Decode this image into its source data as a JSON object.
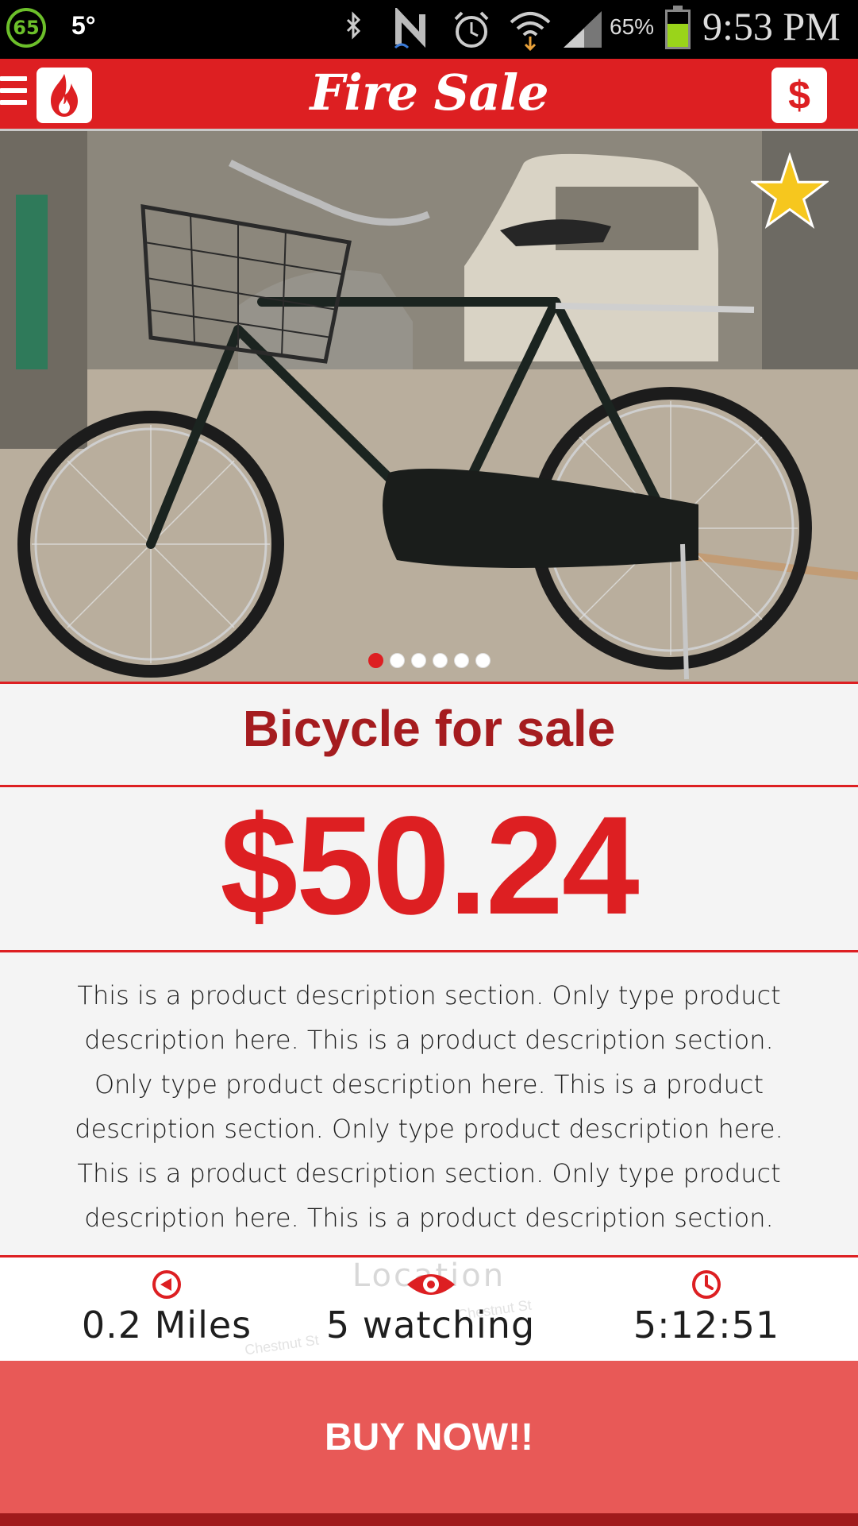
{
  "status_bar": {
    "notification_badge": "65",
    "temperature": "5°",
    "battery_percent": "65%",
    "battery_level": 0.65,
    "time": "9:53 PM",
    "icons": [
      "bluetooth-icon",
      "nfc-icon",
      "alarm-icon",
      "wifi-icon",
      "signal-icon",
      "battery-icon"
    ]
  },
  "header": {
    "title": "Fire Sale",
    "menu_icon": "hamburger-icon",
    "logo_icon": "flame-icon",
    "action_label": "$",
    "brand_color": "#dd1f22"
  },
  "gallery": {
    "image_subject": "bicycle-photo",
    "favorite_icon": "star-icon",
    "favorite_color": "#f6c71e",
    "dots_total": 6,
    "dots_active_index": 0
  },
  "product": {
    "title": "Bicycle for sale",
    "price": "$50.24",
    "description": "This is a product description section. Only type product description here. This is a product description section. Only type product description here. This is a product description section. Only type product description here. This is a product description section. Only type product description here. This is a product description section."
  },
  "stats": {
    "location_label": "Location",
    "streets": [
      "Chestnut St",
      "Chestnut St"
    ],
    "distance": "0.2 Miles",
    "watching": "5 watching",
    "time_left": "5:12:51",
    "distance_icon": "navigate-icon",
    "watching_icon": "eye-icon",
    "time_icon": "clock-icon"
  },
  "buy_button": {
    "label": "BUY NOW!!",
    "color": "#e85957"
  }
}
